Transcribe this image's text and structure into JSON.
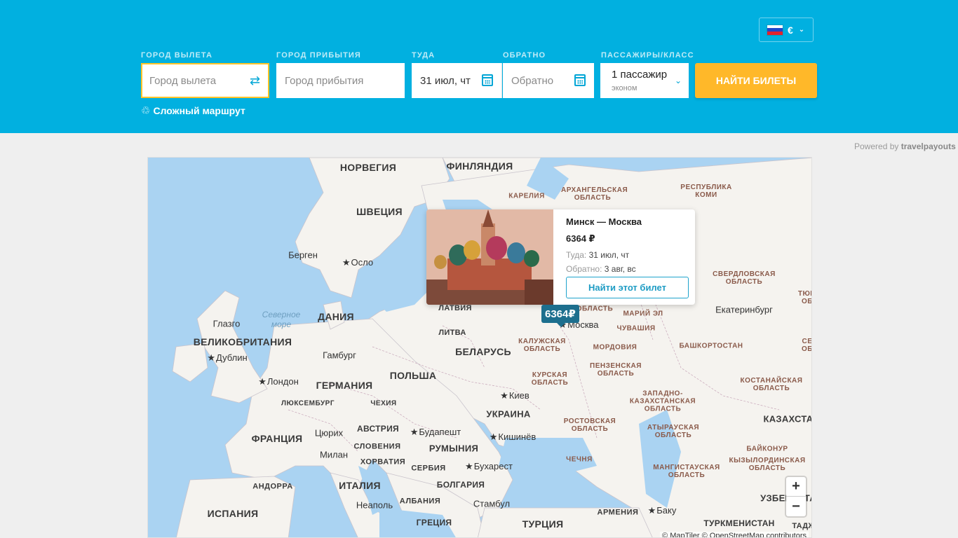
{
  "header": {
    "currency": "€",
    "fields": {
      "origin_label": "ГОРОД ВЫЛЕТА",
      "origin_placeholder": "Город вылета",
      "destination_label": "ГОРОД ПРИБЫТИЯ",
      "destination_placeholder": "Город прибытия",
      "depart_label": "ТУДА",
      "depart_value": "31 июл, чт",
      "return_label": "ОБРАТНО",
      "return_placeholder": "Обратно",
      "passengers_label": "ПАССАЖИРЫ/КЛАСС",
      "passengers_value": "1 пассажир",
      "class_value": "эконом"
    },
    "search_button": "НАЙТИ БИЛЕТЫ",
    "complex_route": "Сложный маршрут"
  },
  "powered_by": {
    "prefix": "Powered by",
    "brand": "travelpayouts"
  },
  "map": {
    "popup": {
      "route": "Минск — Москва",
      "price": "6364 ₽",
      "depart_key": "Туда:",
      "depart_value": "31 июл, чт",
      "return_key": "Обратно:",
      "return_value": "3 авг, вс",
      "button": "Найти этот билет"
    },
    "price_pin": "6364₽",
    "attribution": "© MapTiler © OpenStreetMap contributors",
    "zoom_in": "+",
    "zoom_out": "−",
    "labels": {
      "norway": "НОРВЕГИЯ",
      "finland": "ФИНЛЯНДИЯ",
      "sweden": "ШВЕЦИЯ",
      "karelia": "КАРЕЛИЯ",
      "arkhangelsk": "АРХАНГЕЛЬСКАЯ ОБЛАСТЬ",
      "komi": "РЕСПУБЛИКА КОМИ",
      "bergen": "Берген",
      "oslo": "Осло",
      "sverdlovsk": "СВЕРДЛОВСКАЯ ОБЛАСТЬ",
      "tyumen": "ТЮМ ОБ",
      "north_sea": "Северное море",
      "denmark": "ДАНИЯ",
      "latvia": "ЛАТВИЯ",
      "oblast": "ОБЛАСТЬ",
      "mari_el": "МАРИЙ ЭЛ",
      "yekaterinburg": "Екатеринбург",
      "glasgow": "Глазго",
      "moscow": "Москва",
      "lithuania": "ЛИТВА",
      "chuvashia": "ЧУВАШИЯ",
      "uk": "ВЕЛИКОБРИТАНИЯ",
      "kaluga": "КАЛУЖСКАЯ ОБЛАСТЬ",
      "bashkortostan": "БАШКОРТОСТАН",
      "se_cut": "СЕ ОБ",
      "dublin": "Дублин",
      "hamburg": "Гамбург",
      "belarus": "БЕЛАРУСЬ",
      "mordovia": "МОРДОВИЯ",
      "london": "Лондон",
      "penza": "ПЕНЗЕНСКАЯ ОБЛАСТЬ",
      "germany": "ГЕРМАНИЯ",
      "poland": "ПОЛЬША",
      "kursk": "КУРСКАЯ ОБЛАСТЬ",
      "kostanay": "КОСТАНАЙСКАЯ ОБЛАСТЬ",
      "kyiv": "Киев",
      "luxembourg": "ЛЮКСЕМБУРГ",
      "czechia": "ЧЕХИЯ",
      "west_kz": "ЗАПАДНО-КАЗАХСТАНСКАЯ ОБЛАСТЬ",
      "ukraine": "УКРАИНА",
      "kazakhstan": "КАЗАХСТА",
      "rostov": "РОСТОВСКАЯ ОБЛАСТЬ",
      "zurich": "Цюрих",
      "austria": "АВСТРИЯ",
      "budapest": "Будапешт",
      "atyrau": "АТЫРАУСКАЯ ОБЛАСТЬ",
      "france": "ФРАНЦИЯ",
      "chisinau": "Кишинёв",
      "slovenia": "СЛОВЕНИЯ",
      "romania": "РУМЫНИЯ",
      "baikonur": "БАЙКОНУР",
      "milan": "Милан",
      "chechnya": "ЧЕЧНЯ",
      "croatia": "ХОРВАТИЯ",
      "kyzylorda": "КЫЗЫЛОРДИНСКАЯ ОБЛАСТЬ",
      "serbia": "СЕРБИЯ",
      "bucharest": "Бухарест",
      "mangistau": "МАНГИСТАУСКАЯ ОБЛАСТЬ",
      "andorra": "АНДОРРА",
      "italy": "ИТАЛИЯ",
      "bulgaria": "БОЛГАРИЯ",
      "uzbekistan": "УЗБЕКИСТА",
      "naples": "Неаполь",
      "albania": "АЛБАНИЯ",
      "istanbul": "Стамбул",
      "baku": "Баку",
      "spain": "ИСПАНИЯ",
      "armenia": "АРМЕНИЯ",
      "greece": "ГРЕЦИЯ",
      "turkey": "ТУРЦИЯ",
      "turkmenistan": "ТУРКМЕНИСТАН",
      "tajik_cut": "ТАДЖ"
    }
  },
  "colors": {
    "header_bg": "#01b0e0",
    "accent": "#ffb829",
    "pin": "#1d6f8e",
    "sea": "#aad3f2",
    "land": "#f5f3ef"
  }
}
